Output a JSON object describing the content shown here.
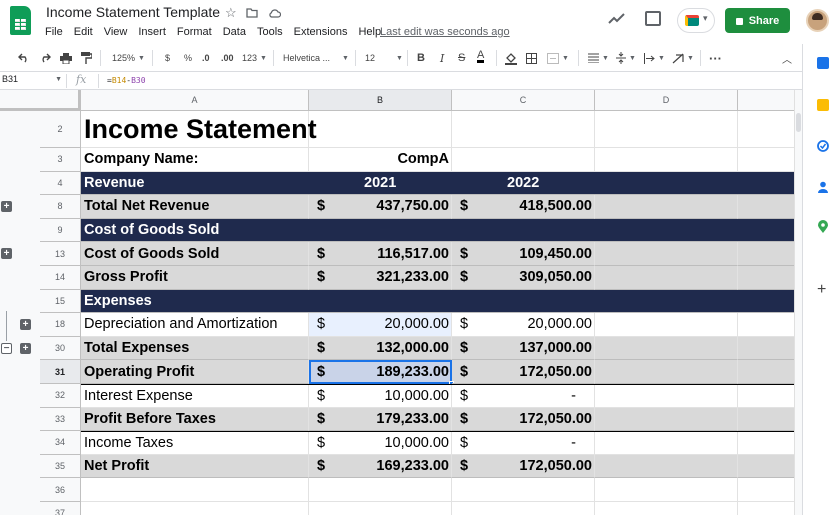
{
  "app": {
    "doc_title": "Income Statement Template",
    "menu": [
      "File",
      "Edit",
      "View",
      "Insert",
      "Format",
      "Data",
      "Tools",
      "Extensions",
      "Help"
    ],
    "last_edit": "Last edit was seconds ago",
    "share_label": "Share"
  },
  "toolbar": {
    "zoom": "125%",
    "currency": "$",
    "percent": "%",
    "dec_decrease": ".0",
    "dec_increase": ".00",
    "more_formats": "123",
    "font": "Helvetica ...",
    "font_size": "12",
    "bold": "B",
    "italic": "I",
    "strike": "S",
    "text_color": "A"
  },
  "formula_bar": {
    "cell_ref": "B31",
    "fx": "fx",
    "formula_eq": "=",
    "formula_ref1": "B14",
    "formula_op": "-",
    "formula_ref2": "B30"
  },
  "columns": [
    "A",
    "B",
    "C",
    "D"
  ],
  "rows": [
    {
      "num": "2",
      "style": "title",
      "a": "Income Statement",
      "b_cur": "",
      "b": "",
      "c_cur": "",
      "c": ""
    },
    {
      "num": "3",
      "style": "plain-bold",
      "a": "Company Name:",
      "b_cur": "",
      "b": "CompA",
      "c_cur": "",
      "c": ""
    },
    {
      "num": "4",
      "style": "header",
      "a": "Revenue",
      "b_cur": "",
      "b": "2021",
      "c_cur": "",
      "c": "2022"
    },
    {
      "num": "8",
      "style": "gray-bold",
      "a": "Total Net Revenue",
      "b_cur": "$",
      "b": "437,750.00",
      "c_cur": "$",
      "c": "418,500.00",
      "group": "plus"
    },
    {
      "num": "9",
      "style": "header",
      "a": "Cost of Goods Sold",
      "b_cur": "",
      "b": "",
      "c_cur": "",
      "c": ""
    },
    {
      "num": "13",
      "style": "gray-bold",
      "a": "Cost of Goods Sold",
      "b_cur": "$",
      "b": "116,517.00",
      "c_cur": "$",
      "c": "109,450.00",
      "group": "plus"
    },
    {
      "num": "14",
      "style": "gray-bold",
      "a": "Gross Profit",
      "b_cur": "$",
      "b": "321,233.00",
      "c_cur": "$",
      "c": "309,050.00"
    },
    {
      "num": "15",
      "style": "header",
      "a": "Expenses",
      "b_cur": "",
      "b": "",
      "c_cur": "",
      "c": ""
    },
    {
      "num": "18",
      "style": "plain",
      "a": "Depreciation and Amortization",
      "b_cur": "$",
      "b": "20,000.00",
      "c_cur": "$",
      "c": "20,000.00",
      "group": "plus-indent"
    },
    {
      "num": "30",
      "style": "gray-bold",
      "a": "Total Expenses",
      "b_cur": "$",
      "b": "132,000.00",
      "c_cur": "$",
      "c": "137,000.00",
      "group": "minus-plus"
    },
    {
      "num": "31",
      "style": "gray-bold",
      "a": "Operating Profit",
      "b_cur": "$",
      "b": "189,233.00",
      "c_cur": "$",
      "c": "172,050.00",
      "selected": true
    },
    {
      "num": "32",
      "style": "plain",
      "a": "Interest Expense",
      "b_cur": "$",
      "b": "10,000.00",
      "c_cur": "$",
      "c": "-"
    },
    {
      "num": "33",
      "style": "gray-bold",
      "a": "Profit Before Taxes",
      "b_cur": "$",
      "b": "179,233.00",
      "c_cur": "$",
      "c": "172,050.00"
    },
    {
      "num": "34",
      "style": "plain",
      "a": "Income Taxes",
      "b_cur": "$",
      "b": "10,000.00",
      "c_cur": "$",
      "c": "-"
    },
    {
      "num": "35",
      "style": "gray-bold",
      "a": "Net Profit",
      "b_cur": "$",
      "b": "169,233.00",
      "c_cur": "$",
      "c": "172,050.00"
    },
    {
      "num": "36",
      "style": "empty",
      "a": "",
      "b_cur": "",
      "b": "",
      "c_cur": "",
      "c": ""
    },
    {
      "num": "37",
      "style": "empty",
      "a": "",
      "b_cur": "",
      "b": "",
      "c_cur": "",
      "c": ""
    }
  ],
  "colors": {
    "header_bg": "#1f2a4d",
    "gray_bg": "#d9d9d9",
    "share_green": "#1e8e3e",
    "selection": "#1a73e8"
  }
}
